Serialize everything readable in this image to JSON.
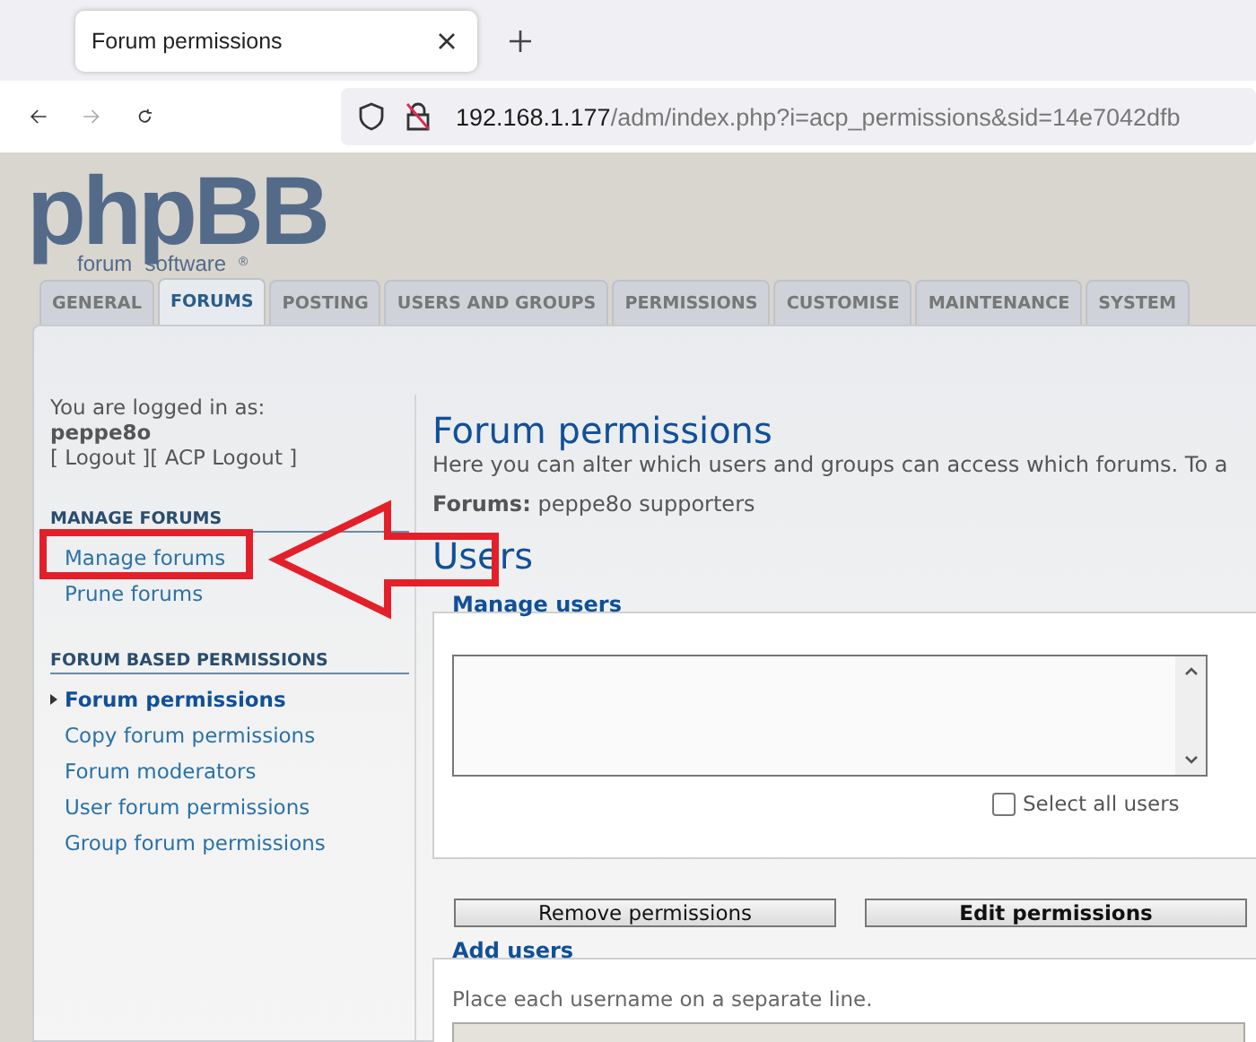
{
  "browser": {
    "tab_title": "Forum permissions",
    "url_host": "192.168.1.177",
    "url_path": "/adm/index.php?i=acp_permissions&sid=14e7042dfb"
  },
  "logo": {
    "wordmark": "phpBB",
    "tagline_1": "forum",
    "tagline_2": "software",
    "mark": "®"
  },
  "tabs": [
    {
      "label": "GENERAL",
      "selected": false
    },
    {
      "label": "FORUMS",
      "selected": true
    },
    {
      "label": "POSTING",
      "selected": false
    },
    {
      "label": "USERS AND GROUPS",
      "selected": false
    },
    {
      "label": "PERMISSIONS",
      "selected": false
    },
    {
      "label": "CUSTOMISE",
      "selected": false
    },
    {
      "label": "MAINTENANCE",
      "selected": false
    },
    {
      "label": "SYSTEM",
      "selected": false
    }
  ],
  "sidebar": {
    "logged_in_label": "You are logged in as:",
    "username": "peppe8o",
    "logout": "[ Logout ]",
    "acp_logout": "[ ACP Logout ]",
    "sections": [
      {
        "heading": "MANAGE FORUMS",
        "items": [
          {
            "label": "Manage forums",
            "selected": false
          },
          {
            "label": "Prune forums",
            "selected": false
          }
        ]
      },
      {
        "heading": "FORUM BASED PERMISSIONS",
        "items": [
          {
            "label": "Forum permissions",
            "selected": true
          },
          {
            "label": "Copy forum permissions",
            "selected": false
          },
          {
            "label": "Forum moderators",
            "selected": false
          },
          {
            "label": "User forum permissions",
            "selected": false
          },
          {
            "label": "Group forum permissions",
            "selected": false
          }
        ]
      }
    ]
  },
  "content": {
    "title": "Forum permissions",
    "description": "Here you can alter which users and groups can access which forums. To a",
    "forums_label": "Forums:",
    "forums_value": "peppe8o supporters",
    "users_heading": "Users",
    "manage_users": {
      "legend": "Manage users",
      "select_all": {
        "label": "Select all users",
        "checked": false
      }
    },
    "buttons": [
      "Remove permissions",
      "Edit permissions"
    ],
    "add_users": {
      "legend": "Add users",
      "hint": "Place each username on a separate line."
    }
  }
}
